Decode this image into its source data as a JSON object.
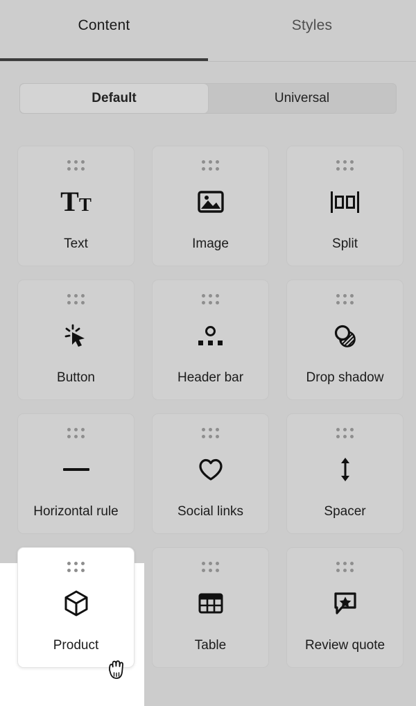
{
  "panel": {
    "tabs": [
      {
        "label": "Content",
        "active": true,
        "name": "tab-content"
      },
      {
        "label": "Styles",
        "active": false,
        "name": "tab-styles"
      }
    ],
    "segmented_control": {
      "options": [
        {
          "label": "Default",
          "selected": true
        },
        {
          "label": "Universal",
          "selected": false
        }
      ]
    },
    "blocks": [
      {
        "label": "Text",
        "icon": "text-tt-icon",
        "highlighted": false
      },
      {
        "label": "Image",
        "icon": "image-icon",
        "highlighted": false
      },
      {
        "label": "Split",
        "icon": "split-icon",
        "highlighted": false
      },
      {
        "label": "Button",
        "icon": "cursor-click-icon",
        "highlighted": false
      },
      {
        "label": "Header bar",
        "icon": "header-bar-icon",
        "highlighted": false
      },
      {
        "label": "Drop shadow",
        "icon": "drop-shadow-icon",
        "highlighted": false
      },
      {
        "label": "Horizontal rule",
        "icon": "horizontal-rule-icon",
        "highlighted": false
      },
      {
        "label": "Social links",
        "icon": "heart-icon",
        "highlighted": false
      },
      {
        "label": "Spacer",
        "icon": "vertical-arrow-icon",
        "highlighted": false
      },
      {
        "label": "Product",
        "icon": "cube-icon",
        "highlighted": true
      },
      {
        "label": "Table",
        "icon": "table-grid-icon",
        "highlighted": false
      },
      {
        "label": "Review quote",
        "icon": "speech-star-icon",
        "highlighted": false
      }
    ],
    "cursor": "grab-hand-cursor",
    "colors": {
      "background": "#cccccc",
      "card": "#d0d0d0",
      "card_highlight": "#ffffff",
      "active_tab_underline": "#3b3b3b",
      "icon": "#111111",
      "drag_dot": "#8e8e8e"
    }
  }
}
